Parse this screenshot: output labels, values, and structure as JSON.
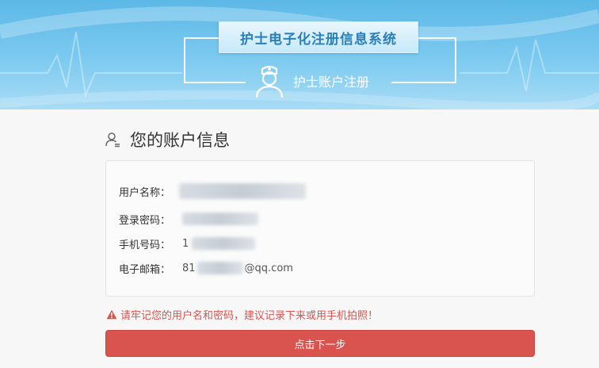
{
  "header": {
    "system_title": "护士电子化注册信息系统",
    "subtitle": "护士账户注册"
  },
  "section": {
    "title": "您的账户信息"
  },
  "account": {
    "username_label": "用户名称：",
    "username_value": "",
    "password_label": "登录密码：",
    "password_value": "",
    "phone_label": "手机号码：",
    "phone_value": "1",
    "email_label": "电子邮箱：",
    "email_prefix": "81",
    "email_suffix": "@qq.com"
  },
  "warning": {
    "text": "请牢记您的用户名和密码，建议记录下来或用手机拍照！"
  },
  "actions": {
    "next_label": "点击下一步"
  },
  "colors": {
    "banner": "#6cc1ec",
    "accent_red": "#d9534f",
    "title_blue": "#2a7fb8"
  },
  "icons": {
    "nurse": "nurse-icon",
    "user": "user-icon",
    "warning": "warning-icon"
  }
}
